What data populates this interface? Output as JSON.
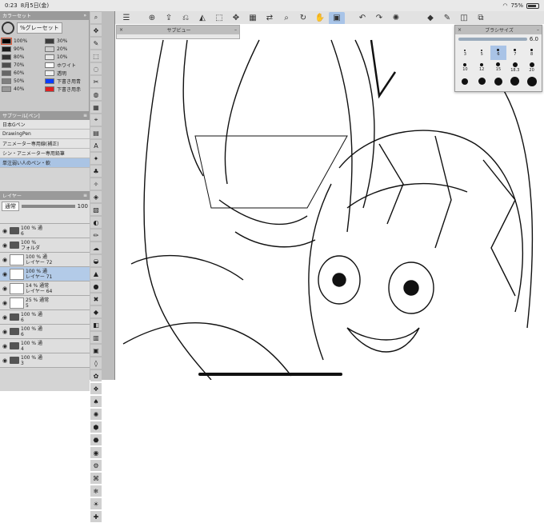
{
  "status": {
    "time": "0:23",
    "date": "8月5日(金)",
    "battery": "75%"
  },
  "panels": {
    "colorset": "カラーセット",
    "subtool": "サブツール[ペン]",
    "layer": "レイヤー",
    "subview": "サブビュー",
    "brushsize": "ブラシサイズ"
  },
  "colorset": {
    "preset": "%グレーセット",
    "rows": [
      {
        "c": "#000000",
        "l": "100%"
      },
      {
        "c": "#3b3b3b",
        "l": "30%"
      },
      {
        "c": "#1a1a1a",
        "l": "90%"
      },
      {
        "c": "#cfcfcf",
        "l": "20%"
      },
      {
        "c": "#333333",
        "l": "80%"
      },
      {
        "c": "#e8e8e8",
        "l": "10%"
      },
      {
        "c": "#4d4d4d",
        "l": "70%"
      },
      {
        "c": "#ffffff",
        "l": "ホワイト"
      },
      {
        "c": "#666666",
        "l": "60%"
      },
      {
        "c": "#f0f0f0",
        "l": "透明"
      },
      {
        "c": "#808080",
        "l": "50%"
      },
      {
        "c": "#0a3cff",
        "l": "下書き用青"
      },
      {
        "c": "#999999",
        "l": "40%"
      },
      {
        "c": "#e02020",
        "l": "下書き用赤"
      }
    ]
  },
  "subtool": {
    "brushes": [
      "日本Gペン",
      "DrawingPen",
      "アニメーター専用線(補正)",
      "シン・アニメーター専用鉛筆",
      "単注弱い人のペン・軟"
    ],
    "selected": 4
  },
  "layer": {
    "blend": "通常",
    "opacity": "100",
    "items": [
      {
        "type": "folder",
        "t1": "100 % 通",
        "t2": "6"
      },
      {
        "type": "folder",
        "t1": "100 %",
        "t2": "フォルダ"
      },
      {
        "type": "layer",
        "t1": "100 % 通",
        "t2": "レイヤー 72"
      },
      {
        "type": "layer",
        "t1": "100 % 通",
        "t2": "レイヤー 71",
        "sel": true
      },
      {
        "type": "layer",
        "t1": "14 % 通常",
        "t2": "レイヤー 64"
      },
      {
        "type": "layer",
        "t1": "25 % 通常",
        "t2": "5"
      },
      {
        "type": "folder",
        "t1": "100 % 通",
        "t2": "6"
      },
      {
        "type": "folder",
        "t1": "100 % 通",
        "t2": "6"
      },
      {
        "type": "folder",
        "t1": "100 % 通",
        "t2": "4"
      },
      {
        "type": "folder",
        "t1": "100 % 通",
        "t2": "3"
      }
    ]
  },
  "brushsize": {
    "value": "6.0",
    "cells": [
      {
        "l": "3",
        "d": 2
      },
      {
        "l": "5",
        "d": 2
      },
      {
        "l": "6",
        "d": 3,
        "sel": true
      },
      {
        "l": "7",
        "d": 3
      },
      {
        "l": "8",
        "d": 3
      },
      {
        "l": "10",
        "d": 4
      },
      {
        "l": "12",
        "d": 4
      },
      {
        "l": "15",
        "d": 5
      },
      {
        "l": "18.3",
        "d": 6
      },
      {
        "l": "20",
        "d": 6
      },
      {
        "l": "",
        "d": 8
      },
      {
        "l": "",
        "d": 9
      },
      {
        "l": "",
        "d": 10
      },
      {
        "l": "",
        "d": 11
      },
      {
        "l": "",
        "d": 12
      }
    ]
  },
  "toolbar_icons": [
    "menu-icon",
    "new-icon",
    "save-icon",
    "undo-alt-icon",
    "fill-icon",
    "transform-icon",
    "move-icon",
    "grid-icon",
    "flip-icon",
    "zoom-icon",
    "rotate-icon",
    "hand-icon",
    "select-icon",
    "undo-icon",
    "redo-icon",
    "settings-icon",
    "fill-color-icon",
    "pen-icon",
    "square-icon",
    "copy-icon"
  ]
}
